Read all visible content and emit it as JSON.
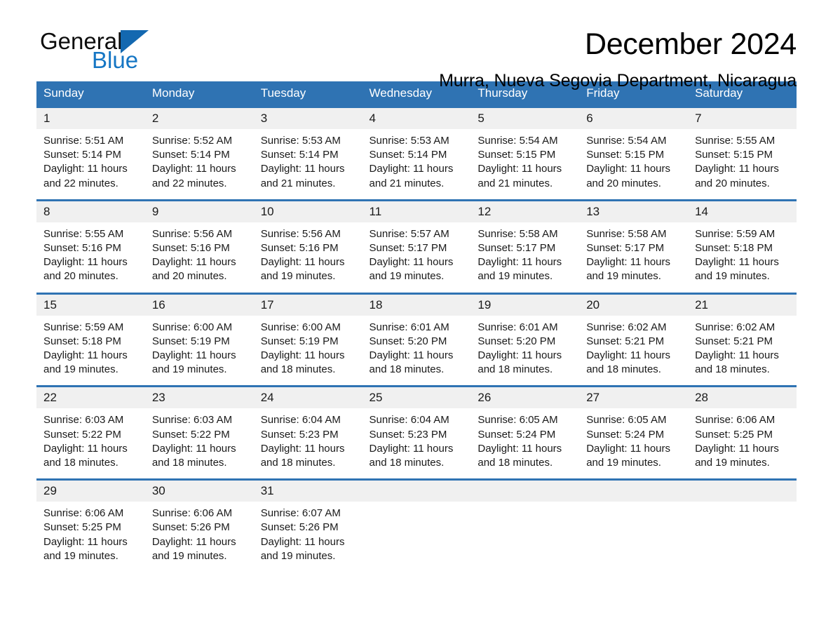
{
  "brand": {
    "name_top": "General",
    "name_bottom": "Blue",
    "accent_color": "#1576c4",
    "logo_triangle_color": "#1368b0"
  },
  "header": {
    "title": "December 2024",
    "subtitle": "Murra, Nueva Segovia Department, Nicaragua"
  },
  "calendar": {
    "header_bg": "#2f73b3",
    "daynum_bg": "#f0f0f0",
    "weekday_headers": [
      "Sunday",
      "Monday",
      "Tuesday",
      "Wednesday",
      "Thursday",
      "Friday",
      "Saturday"
    ],
    "weeks": [
      [
        {
          "day": "1",
          "sunrise": "Sunrise: 5:51 AM",
          "sunset": "Sunset: 5:14 PM",
          "daylight": "Daylight: 11 hours and 22 minutes."
        },
        {
          "day": "2",
          "sunrise": "Sunrise: 5:52 AM",
          "sunset": "Sunset: 5:14 PM",
          "daylight": "Daylight: 11 hours and 22 minutes."
        },
        {
          "day": "3",
          "sunrise": "Sunrise: 5:53 AM",
          "sunset": "Sunset: 5:14 PM",
          "daylight": "Daylight: 11 hours and 21 minutes."
        },
        {
          "day": "4",
          "sunrise": "Sunrise: 5:53 AM",
          "sunset": "Sunset: 5:14 PM",
          "daylight": "Daylight: 11 hours and 21 minutes."
        },
        {
          "day": "5",
          "sunrise": "Sunrise: 5:54 AM",
          "sunset": "Sunset: 5:15 PM",
          "daylight": "Daylight: 11 hours and 21 minutes."
        },
        {
          "day": "6",
          "sunrise": "Sunrise: 5:54 AM",
          "sunset": "Sunset: 5:15 PM",
          "daylight": "Daylight: 11 hours and 20 minutes."
        },
        {
          "day": "7",
          "sunrise": "Sunrise: 5:55 AM",
          "sunset": "Sunset: 5:15 PM",
          "daylight": "Daylight: 11 hours and 20 minutes."
        }
      ],
      [
        {
          "day": "8",
          "sunrise": "Sunrise: 5:55 AM",
          "sunset": "Sunset: 5:16 PM",
          "daylight": "Daylight: 11 hours and 20 minutes."
        },
        {
          "day": "9",
          "sunrise": "Sunrise: 5:56 AM",
          "sunset": "Sunset: 5:16 PM",
          "daylight": "Daylight: 11 hours and 20 minutes."
        },
        {
          "day": "10",
          "sunrise": "Sunrise: 5:56 AM",
          "sunset": "Sunset: 5:16 PM",
          "daylight": "Daylight: 11 hours and 19 minutes."
        },
        {
          "day": "11",
          "sunrise": "Sunrise: 5:57 AM",
          "sunset": "Sunset: 5:17 PM",
          "daylight": "Daylight: 11 hours and 19 minutes."
        },
        {
          "day": "12",
          "sunrise": "Sunrise: 5:58 AM",
          "sunset": "Sunset: 5:17 PM",
          "daylight": "Daylight: 11 hours and 19 minutes."
        },
        {
          "day": "13",
          "sunrise": "Sunrise: 5:58 AM",
          "sunset": "Sunset: 5:17 PM",
          "daylight": "Daylight: 11 hours and 19 minutes."
        },
        {
          "day": "14",
          "sunrise": "Sunrise: 5:59 AM",
          "sunset": "Sunset: 5:18 PM",
          "daylight": "Daylight: 11 hours and 19 minutes."
        }
      ],
      [
        {
          "day": "15",
          "sunrise": "Sunrise: 5:59 AM",
          "sunset": "Sunset: 5:18 PM",
          "daylight": "Daylight: 11 hours and 19 minutes."
        },
        {
          "day": "16",
          "sunrise": "Sunrise: 6:00 AM",
          "sunset": "Sunset: 5:19 PM",
          "daylight": "Daylight: 11 hours and 19 minutes."
        },
        {
          "day": "17",
          "sunrise": "Sunrise: 6:00 AM",
          "sunset": "Sunset: 5:19 PM",
          "daylight": "Daylight: 11 hours and 18 minutes."
        },
        {
          "day": "18",
          "sunrise": "Sunrise: 6:01 AM",
          "sunset": "Sunset: 5:20 PM",
          "daylight": "Daylight: 11 hours and 18 minutes."
        },
        {
          "day": "19",
          "sunrise": "Sunrise: 6:01 AM",
          "sunset": "Sunset: 5:20 PM",
          "daylight": "Daylight: 11 hours and 18 minutes."
        },
        {
          "day": "20",
          "sunrise": "Sunrise: 6:02 AM",
          "sunset": "Sunset: 5:21 PM",
          "daylight": "Daylight: 11 hours and 18 minutes."
        },
        {
          "day": "21",
          "sunrise": "Sunrise: 6:02 AM",
          "sunset": "Sunset: 5:21 PM",
          "daylight": "Daylight: 11 hours and 18 minutes."
        }
      ],
      [
        {
          "day": "22",
          "sunrise": "Sunrise: 6:03 AM",
          "sunset": "Sunset: 5:22 PM",
          "daylight": "Daylight: 11 hours and 18 minutes."
        },
        {
          "day": "23",
          "sunrise": "Sunrise: 6:03 AM",
          "sunset": "Sunset: 5:22 PM",
          "daylight": "Daylight: 11 hours and 18 minutes."
        },
        {
          "day": "24",
          "sunrise": "Sunrise: 6:04 AM",
          "sunset": "Sunset: 5:23 PM",
          "daylight": "Daylight: 11 hours and 18 minutes."
        },
        {
          "day": "25",
          "sunrise": "Sunrise: 6:04 AM",
          "sunset": "Sunset: 5:23 PM",
          "daylight": "Daylight: 11 hours and 18 minutes."
        },
        {
          "day": "26",
          "sunrise": "Sunrise: 6:05 AM",
          "sunset": "Sunset: 5:24 PM",
          "daylight": "Daylight: 11 hours and 18 minutes."
        },
        {
          "day": "27",
          "sunrise": "Sunrise: 6:05 AM",
          "sunset": "Sunset: 5:24 PM",
          "daylight": "Daylight: 11 hours and 19 minutes."
        },
        {
          "day": "28",
          "sunrise": "Sunrise: 6:06 AM",
          "sunset": "Sunset: 5:25 PM",
          "daylight": "Daylight: 11 hours and 19 minutes."
        }
      ],
      [
        {
          "day": "29",
          "sunrise": "Sunrise: 6:06 AM",
          "sunset": "Sunset: 5:25 PM",
          "daylight": "Daylight: 11 hours and 19 minutes."
        },
        {
          "day": "30",
          "sunrise": "Sunrise: 6:06 AM",
          "sunset": "Sunset: 5:26 PM",
          "daylight": "Daylight: 11 hours and 19 minutes."
        },
        {
          "day": "31",
          "sunrise": "Sunrise: 6:07 AM",
          "sunset": "Sunset: 5:26 PM",
          "daylight": "Daylight: 11 hours and 19 minutes."
        },
        {
          "day": "",
          "sunrise": "",
          "sunset": "",
          "daylight": ""
        },
        {
          "day": "",
          "sunrise": "",
          "sunset": "",
          "daylight": ""
        },
        {
          "day": "",
          "sunrise": "",
          "sunset": "",
          "daylight": ""
        },
        {
          "day": "",
          "sunrise": "",
          "sunset": "",
          "daylight": ""
        }
      ]
    ]
  }
}
